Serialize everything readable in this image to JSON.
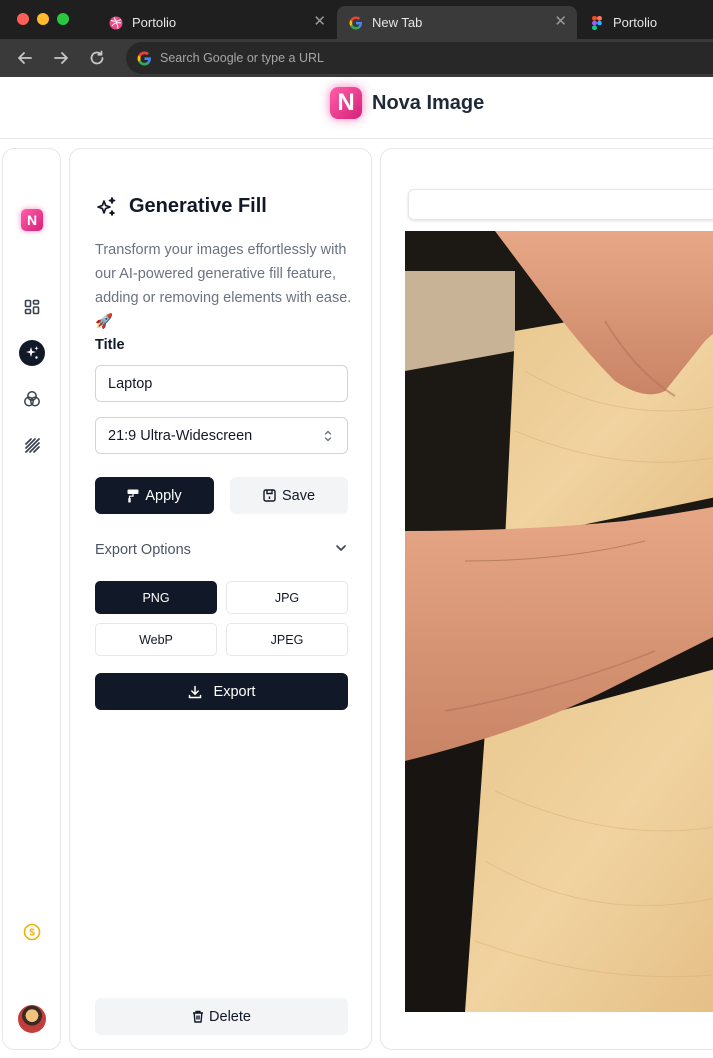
{
  "browser": {
    "tabs": [
      {
        "title": "Portolio",
        "icon": "dribbble-icon",
        "active": false
      },
      {
        "title": "New Tab",
        "icon": "google-icon",
        "active": true
      },
      {
        "title": "Portolio",
        "icon": "figma-icon",
        "active": false
      }
    ],
    "address_placeholder": "Search Google or type a URL",
    "colors": {
      "chrome_dark": "#1f1f1f",
      "tab_active": "#3a3a3a"
    }
  },
  "app": {
    "logo_letter": "N",
    "name": "Nova Image",
    "brand_color": "#ec4899"
  },
  "sidebar": {
    "items": [
      {
        "name": "logo",
        "icon": "nova-logo-icon"
      },
      {
        "name": "dashboard",
        "icon": "grid-icon"
      },
      {
        "name": "generative-fill",
        "icon": "sparkles-icon",
        "active": true
      },
      {
        "name": "filters",
        "icon": "circles-icon"
      },
      {
        "name": "patterns",
        "icon": "stripes-icon"
      },
      {
        "name": "credits",
        "icon": "coin-icon"
      },
      {
        "name": "profile",
        "icon": "avatar-icon"
      }
    ]
  },
  "panel": {
    "title": "Generative Fill",
    "description": "Transform your images effortlessly with our AI-powered generative fill feature, adding or removing elements with ease. 🚀",
    "title_label": "Title",
    "title_value": "Laptop",
    "aspect_ratio": "21:9 Ultra-Widescreen",
    "apply_label": "Apply",
    "save_label": "Save",
    "export_options_label": "Export Options",
    "formats": [
      "PNG",
      "JPG",
      "WebP",
      "JPEG"
    ],
    "selected_format": "PNG",
    "export_label": "Export",
    "delete_label": "Delete"
  }
}
